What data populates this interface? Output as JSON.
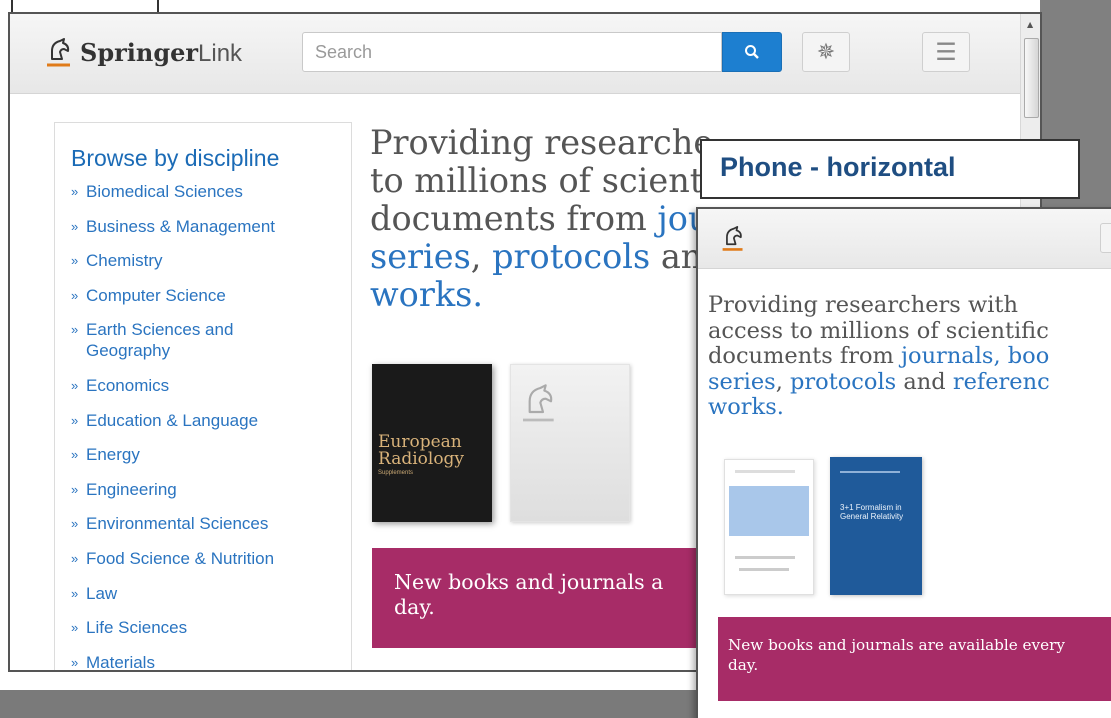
{
  "main": {
    "logo": {
      "brand": "Springer",
      "suffix": "Link"
    },
    "search": {
      "placeholder": "Search",
      "value": ""
    },
    "icons": {
      "search": "search-icon",
      "settings": "gear-icon",
      "menu": "hamburger-menu-icon"
    },
    "sidebar": {
      "title": "Browse by discipline",
      "items": [
        "Biomedical Sciences",
        "Business & Management",
        "Chemistry",
        "Computer Science",
        "Earth Sciences and Geography",
        "Economics",
        "Education & Language",
        "Energy",
        "Engineering",
        "Environmental Sciences",
        "Food Science & Nutrition",
        "Law",
        "Life Sciences",
        "Materials"
      ]
    },
    "intro": {
      "line1": "Providing researche",
      "line2": "to millions of scient",
      "line3_text": "documents from ",
      "line3_link": "jou",
      "line4_link1": "series",
      "line4_sep": ", ",
      "line4_link2": "protocols",
      "line4_text": " an",
      "line5_link": "works."
    },
    "covers": [
      {
        "title_line1": "European",
        "title_line2": "Radiology",
        "subtitle": "Supplements"
      },
      {
        "title": ""
      }
    ],
    "banner": "New books and journals a day."
  },
  "phone": {
    "label": "Phone - horizontal",
    "intro": {
      "line1": "Providing researchers with",
      "line2": "access to millions of scientific",
      "line3_text": "documents from ",
      "line3_link": "journals",
      "line3_tail": ", boo",
      "line4_link1": "series",
      "line4_sep": ", ",
      "line4_link2": "protocols",
      "line4_text": " and ",
      "line4_link3": "referenc",
      "line5_link": "works."
    },
    "covers": [
      {
        "title": ""
      },
      {
        "title": "3+1 Formalism in General Relativity"
      }
    ],
    "banner": "New books and journals are available every day."
  },
  "colors": {
    "link_blue": "#2a74c0",
    "banner_magenta": "#a72c67",
    "search_blue": "#1d7fd0",
    "label_navy": "#1f4e82"
  }
}
